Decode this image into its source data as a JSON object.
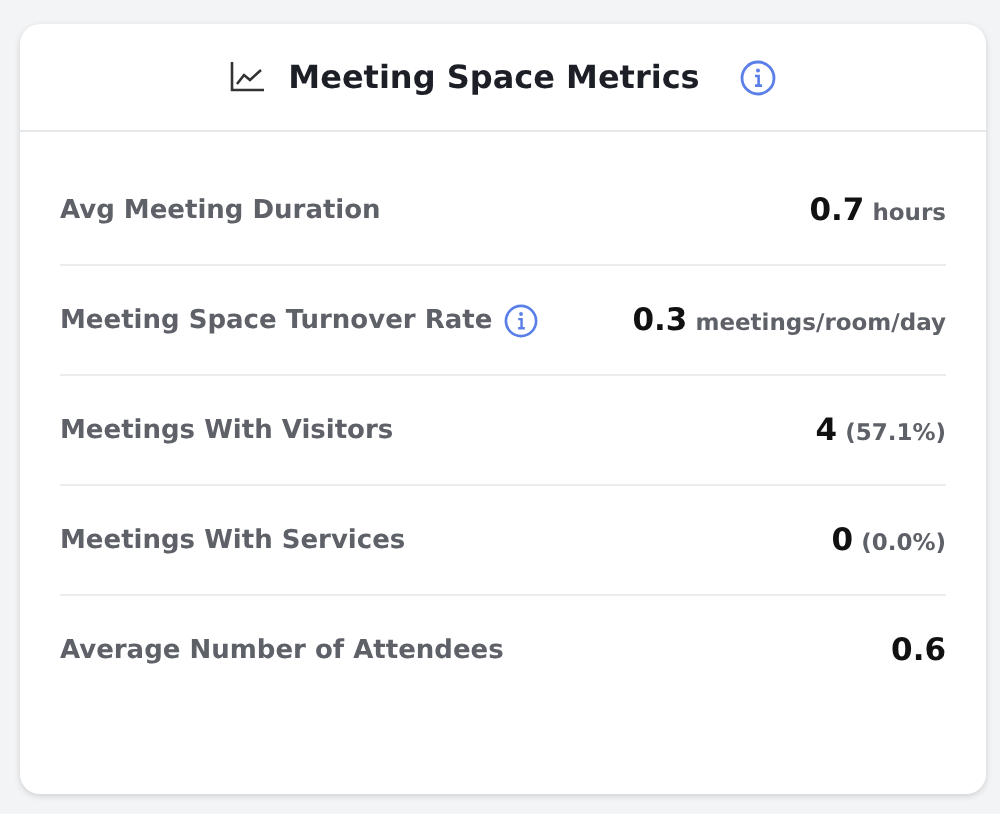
{
  "card": {
    "title": "Meeting Space Metrics",
    "title_info": true
  },
  "metrics": [
    {
      "label": "Avg Meeting Duration",
      "info": false,
      "value": "0.7",
      "unit": "hours"
    },
    {
      "label": "Meeting Space Turnover Rate",
      "info": true,
      "value": "0.3",
      "unit": "meetings/room/day"
    },
    {
      "label": "Meetings With Visitors",
      "info": false,
      "value": "4",
      "unit": "(57.1%)"
    },
    {
      "label": "Meetings With Services",
      "info": false,
      "value": "0",
      "unit": "(0.0%)"
    },
    {
      "label": "Average Number of Attendees",
      "info": false,
      "value": "0.6"
    }
  ]
}
